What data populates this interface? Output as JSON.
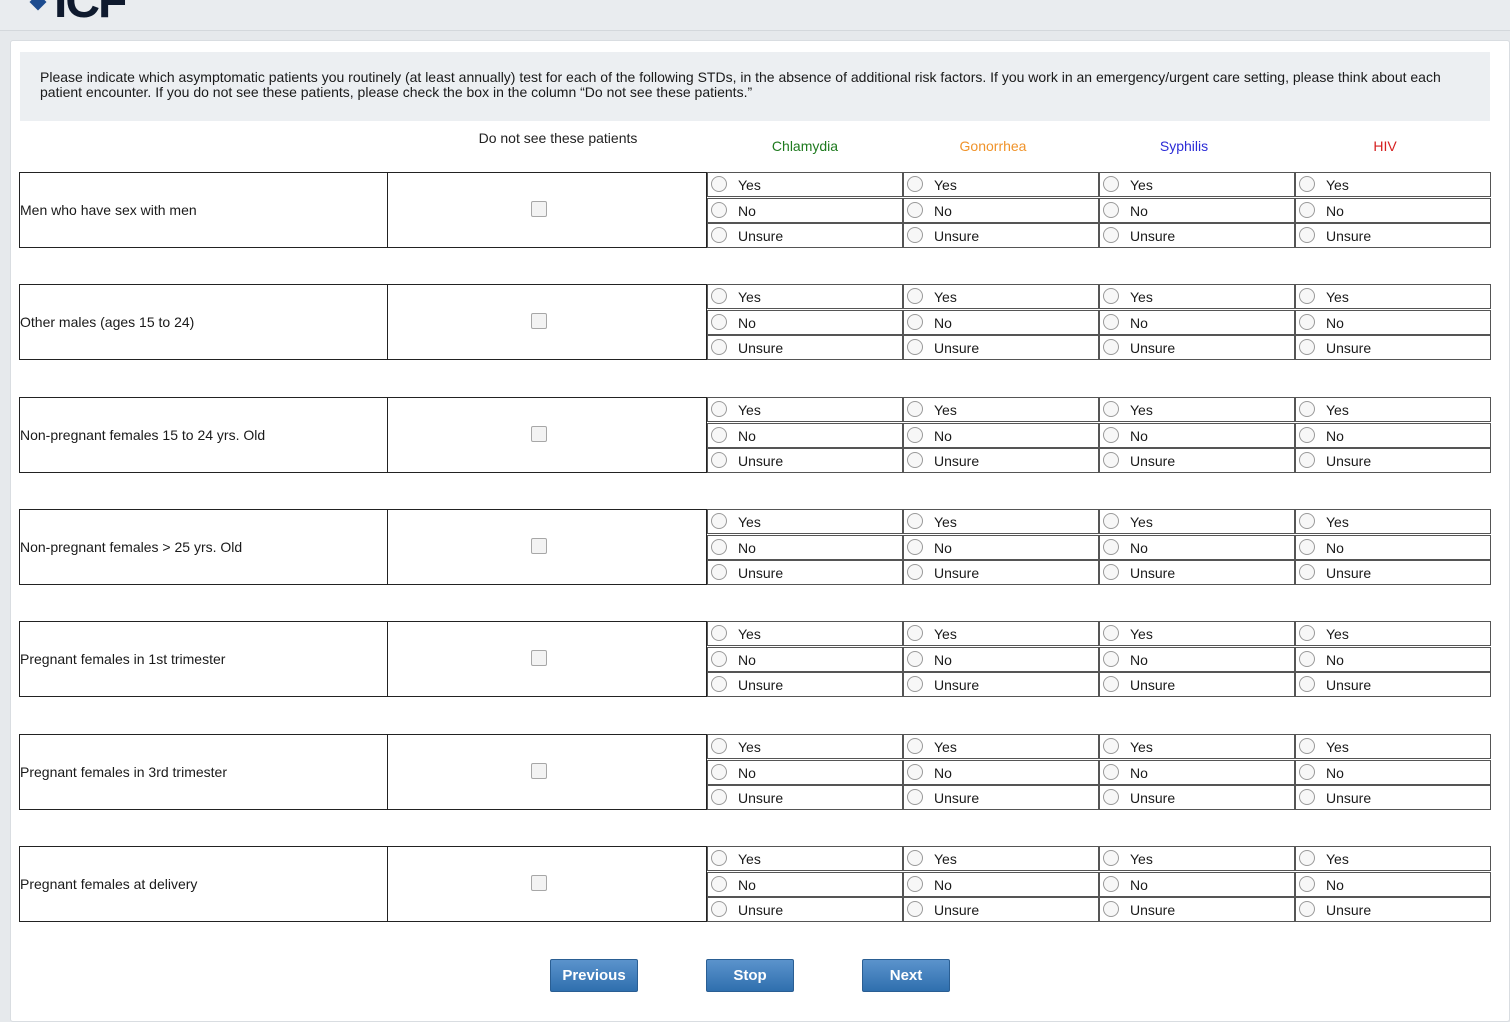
{
  "header": {
    "logo_text": "ICF"
  },
  "instructions": "Please indicate which asymptomatic patients you routinely (at least annually) test for each of the following STDs, in the absence of additional risk factors. If you work in an emergency/urgent care setting, please think about each patient encounter. If you do not see these patients, please check the box in the column “Do not see these patients.”",
  "columns": {
    "do_not_see": "Do not see these patients",
    "diseases": [
      {
        "label": "Chlamydia",
        "color": "#1e7a1e"
      },
      {
        "label": "Gonorrhea",
        "color": "#f0932a"
      },
      {
        "label": "Syphilis",
        "color": "#2b2bd6"
      },
      {
        "label": "HIV",
        "color": "#d62020"
      }
    ]
  },
  "options": [
    "Yes",
    "No",
    "Unsure"
  ],
  "rows": [
    {
      "label": "Men who have sex with men"
    },
    {
      "label": "Other males (ages 15 to 24)"
    },
    {
      "label": "Non-pregnant females 15 to 24 yrs. Old"
    },
    {
      "label": "Non-pregnant females > 25 yrs. Old"
    },
    {
      "label": "Pregnant females in 1st trimester"
    },
    {
      "label": "Pregnant females in 3rd trimester"
    },
    {
      "label": "Pregnant females at delivery"
    }
  ],
  "buttons": {
    "previous": "Previous",
    "stop": "Stop",
    "next": "Next"
  }
}
